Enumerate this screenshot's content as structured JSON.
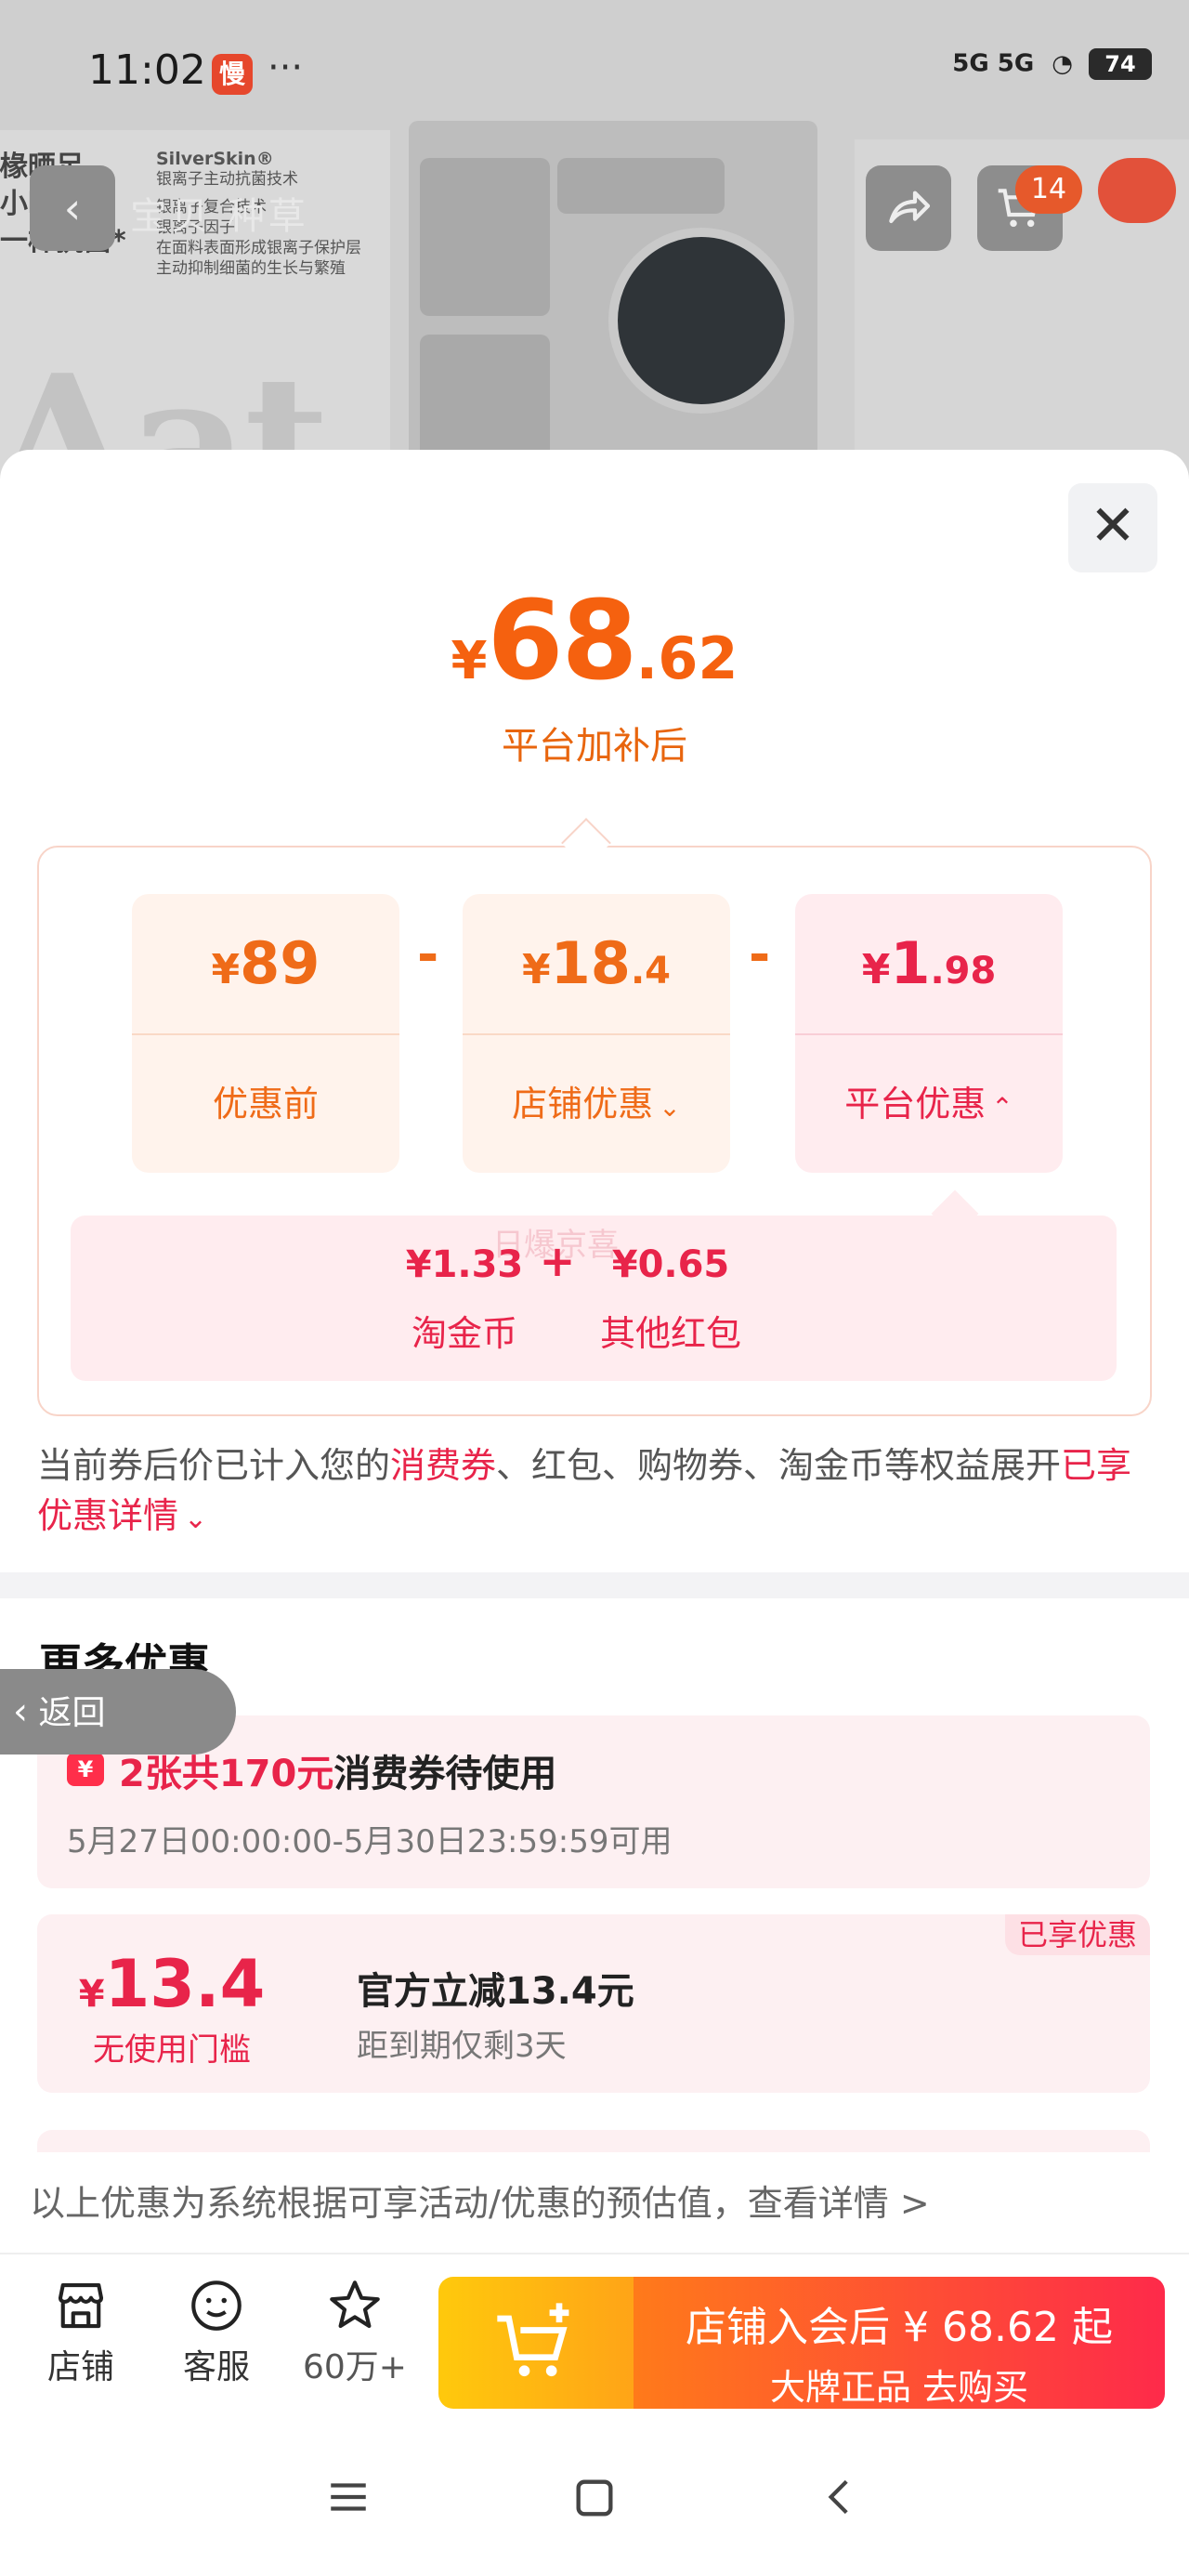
{
  "status_bar": {
    "time": "11:02",
    "app_badge": "慢",
    "more": "···",
    "network": "5G 5G",
    "battery": "74"
  },
  "background": {
    "copy_lines": [
      "椽晒足",
      "小时阳光",
      "一样抗菌*"
    ],
    "brand": "SilverSkin®",
    "brand_sub": "银离子主动抗菌技术",
    "brand_lines": [
      "银离子复合技术",
      "银离子因子",
      "在面料表面形成银离子保护层",
      "主动抑制细菌的生长与繁殖"
    ],
    "ghost_tabs": "宝贝  种草",
    "big_text": "Aat",
    "cart_count": "14"
  },
  "price": {
    "currency": "¥",
    "int": "68",
    "dec": ".62",
    "subtitle": "平台加补后"
  },
  "breakdown": {
    "cards": [
      {
        "cur": "¥",
        "int": "89",
        "dec": "",
        "label": "优惠前"
      },
      {
        "cur": "¥",
        "int": "18",
        "dec": ".4",
        "label": "店铺优惠"
      },
      {
        "cur": "¥",
        "int": "1",
        "dec": ".98",
        "label": "平台优惠"
      }
    ],
    "op1": "-",
    "op2": "-",
    "platform": {
      "a_amount": "¥1.33",
      "a_label": "淘金币",
      "plus": "+",
      "b_amount": "¥0.65",
      "b_label": "其他红包",
      "watermark": "日爆京喜"
    }
  },
  "notice": {
    "p1": "当前券后价已计入您的",
    "hl1": "消费券",
    "p2": "、红包、购物券、淘金币等权益展开",
    "link": "已享优惠详情"
  },
  "more": {
    "title": "更多优惠",
    "back": "返回",
    "coupon1": {
      "icon": "¥",
      "title_hl": "2张共170元",
      "title": "消费券待使用",
      "time": "5月27日00:00:00-5月30日23:59:59可用"
    },
    "coupon2": {
      "cur": "¥",
      "amount": "13.4",
      "threshold": "无使用门槛",
      "title": "官方立减13.4元",
      "expire": "距到期仅剩3天",
      "tag": "已享优惠"
    }
  },
  "estimate": "以上优惠为系统根据可享活动/优惠的预估值，查看详情 >",
  "bottom_nav": {
    "store": "店铺",
    "service": "客服",
    "favorites": "60万+",
    "buy_line1": "店铺入会后 ¥ 68.62 起",
    "buy_line2": "大牌正品  去购买"
  },
  "colors": {
    "orange": "#f5610f",
    "red": "#e8244a"
  }
}
